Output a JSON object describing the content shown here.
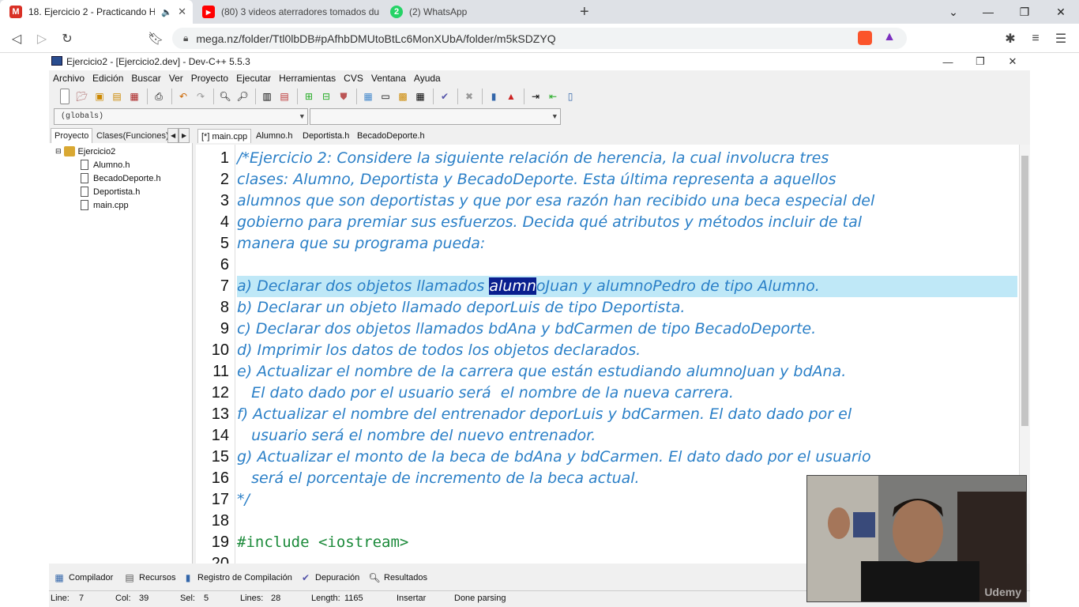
{
  "browser": {
    "tabs": [
      {
        "title": "18. Ejercicio 2 - Practicando H",
        "favicon": "gmail-icon",
        "color": "#d93025",
        "active": true
      },
      {
        "title": "(80) 3 videos aterradores tomados du",
        "favicon": "youtube-icon",
        "color": "#ff0000",
        "active": false
      },
      {
        "title": "(2) WhatsApp",
        "favicon": "whatsapp-icon",
        "color": "#25d366",
        "active": false
      }
    ],
    "new_tab": "+",
    "url": "mega.nz/folder/Ttl0lbDB#pAfhbDMUtoBtLc6MonXUbA/folder/m5kSDZYQ"
  },
  "devcpp": {
    "title": "Ejercicio2 - [Ejercicio2.dev] - Dev-C++ 5.5.3",
    "menu": [
      "Archivo",
      "Edición",
      "Buscar",
      "Ver",
      "Proyecto",
      "Ejecutar",
      "Herramientas",
      "CVS",
      "Ventana",
      "Ayuda"
    ],
    "globals_combo": "(globals)",
    "left_tabs": [
      "Proyecto",
      "Clases(Funciones)"
    ],
    "tree": {
      "project": "Ejercicio2",
      "files": [
        "Alumno.h",
        "BecadoDeporte.h",
        "Deportista.h",
        "main.cpp"
      ]
    },
    "editor_tabs": [
      "[*] main.cpp",
      "Alumno.h",
      "Deportista.h",
      "BecadoDeporte.h"
    ],
    "code_lines": [
      {
        "n": "1",
        "text": "/*Ejercicio 2: Considere la siguiente relación de herencia, la cual involucra tres"
      },
      {
        "n": "2",
        "text": "clases: Alumno, Deportista y BecadoDeporte. Esta última representa a aquellos"
      },
      {
        "n": "3",
        "text": "alumnos que son deportistas y que por esa razón han recibido una beca especial del"
      },
      {
        "n": "4",
        "text": "gobierno para premiar sus esfuerzos. Decida qué atributos y métodos incluir de tal"
      },
      {
        "n": "5",
        "text": "manera que su programa pueda:"
      },
      {
        "n": "6",
        "text": ""
      },
      {
        "n": "7",
        "text_before": "a) Declarar dos objetos llamados ",
        "selected": "alumn",
        "text_after": "oJuan y alumnoPedro de tipo Alumno."
      },
      {
        "n": "8",
        "text": "b) Declarar un objeto llamado deporLuis de tipo Deportista."
      },
      {
        "n": "9",
        "text": "c) Declarar dos objetos llamados bdAna y bdCarmen de tipo BecadoDeporte."
      },
      {
        "n": "10",
        "text": "d) Imprimir los datos de todos los objetos declarados."
      },
      {
        "n": "11",
        "text": "e) Actualizar el nombre de la carrera que están estudiando alumnoJuan y bdAna."
      },
      {
        "n": "12",
        "text": "   El dato dado por el usuario será  el nombre de la nueva carrera."
      },
      {
        "n": "13",
        "text": "f) Actualizar el nombre del entrenador deporLuis y bdCarmen. El dato dado por el"
      },
      {
        "n": "14",
        "text": "   usuario será el nombre del nuevo entrenador."
      },
      {
        "n": "15",
        "text": "g) Actualizar el monto de la beca de bdAna y bdCarmen. El dato dado por el usuario"
      },
      {
        "n": "16",
        "text": "   será el porcentaje de incremento de la beca actual."
      },
      {
        "n": "17",
        "text": "*/"
      },
      {
        "n": "18",
        "text": ""
      },
      {
        "n": "19",
        "text": "#include <iostream>"
      },
      {
        "n": "20",
        "text": ""
      }
    ],
    "bottom_tabs": [
      "Compilador",
      "Recursos",
      "Registro de Compilación",
      "Depuración",
      "Resultados"
    ],
    "status": {
      "line_label": "Line:",
      "line": "7",
      "col_label": "Col:",
      "col": "39",
      "sel_label": "Sel:",
      "sel": "5",
      "lines_label": "Lines:",
      "lines": "28",
      "length_label": "Length:",
      "length": "1165",
      "mode": "Insertar",
      "message": "Done parsing"
    }
  },
  "webcam": {
    "watermark": "Udemy"
  }
}
